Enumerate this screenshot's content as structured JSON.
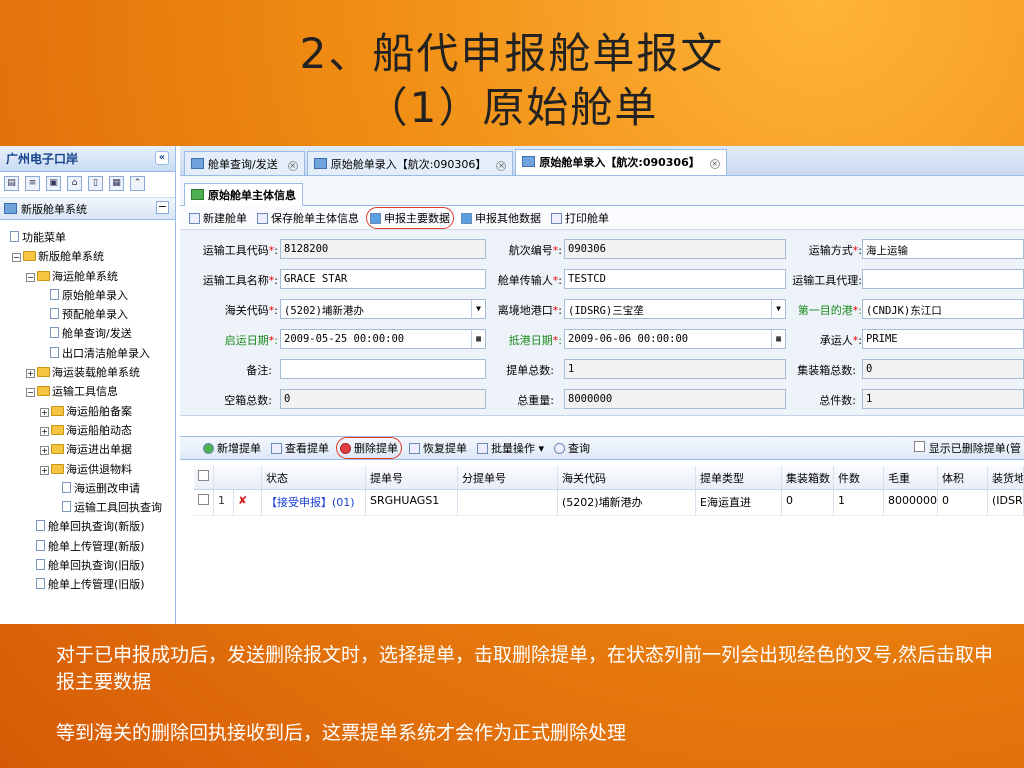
{
  "slide": {
    "title_line1": "2、船代申报舱单报文",
    "title_line2": "（1）原始舱单",
    "caption1": "对于已申报成功后，发送删除报文时，选择提单，击取删除提单，在状态列前一列会出现经色的叉号,然后击取申报主要数据",
    "caption2": "等到海关的删除回执接收到后，这票提单系统才会作为正式删除处理"
  },
  "left_panel": {
    "title": "广州电子口岸",
    "section": "新版舱单系统",
    "tree": {
      "root": "功能菜单",
      "l1": "新版舱单系统",
      "group_sea": "海运舱单系统",
      "sea_items": [
        "原始舱单录入",
        "预配舱单录入",
        "舱单查询/发送",
        "出口清洁舱单录入"
      ],
      "group_load": "海运装载舱单系统",
      "group_tool": "运输工具信息",
      "tool_items": [
        "海运船舶备案",
        "海运船舶动态",
        "海运进出单据",
        "海运供退物料",
        "海运删改申请",
        "运输工具回执查询"
      ],
      "extra_items": [
        "舱单回执查询(新版)",
        "舱单上传管理(新版)",
        "舱单回执查询(旧版)",
        "舱单上传管理(旧版)"
      ]
    }
  },
  "tabs": [
    {
      "label": "舱单查询/发送"
    },
    {
      "label": "原始舱单录入【航次:090306】"
    },
    {
      "label": "原始舱单录入【航次:090306】"
    }
  ],
  "subtab": "原始舱单主体信息",
  "toolbar": {
    "new": "新建舱单",
    "save": "保存舱单主体信息",
    "declare_main": "申报主要数据",
    "declare_other": "申报其他数据",
    "print": "打印舱单"
  },
  "form": {
    "tool_code_label": "运输工具代码",
    "tool_code": "8128200",
    "voyage_label": "航次编号",
    "voyage": "090306",
    "transport_mode_label": "运输方式",
    "transport_mode": "海上运输",
    "tool_name_label": "运输工具名称",
    "tool_name": "GRACE STAR",
    "carrier_label": "舱单传输人",
    "carrier": "TESTCD",
    "agent_label": "运输工具代理:",
    "agent": "",
    "customs_label": "海关代码",
    "customs": "(5202)埔新港办",
    "departure_port_label": "离境地港口",
    "departure_port": "(IDSRG)三宝垄",
    "dest_port_label": "第一目的港",
    "dest_port": "(CNDJK)东江口",
    "start_date_label": "启运日期",
    "start_date": "2009-05-25 00:00:00",
    "arrive_date_label": "抵港日期",
    "arrive_date": "2009-06-06 00:00:00",
    "shipper_label": "承运人",
    "shipper": "PRIME",
    "remark_label": "备注:",
    "remark": "",
    "bill_total_label": "提单总数:",
    "bill_total": "1",
    "container_total_label": "集装箱总数:",
    "container_total": "0",
    "empty_total_label": "空箱总数:",
    "empty_total": "0",
    "weight_label": "总重量:",
    "weight": "8000000",
    "pieces_label": "总件数:",
    "pieces": "1"
  },
  "grid_toolbar": {
    "add": "新增提单",
    "view": "查看提单",
    "delete": "删除提单",
    "restore": "恢复提单",
    "batch": "批量操作",
    "query": "查询",
    "show_deleted": "显示已删除提单(管"
  },
  "grid": {
    "headers": [
      "状态",
      "提单号",
      "分提单号",
      "海关代码",
      "提单类型",
      "集装箱数",
      "件数",
      "毛重",
      "体积",
      "装货地"
    ],
    "rows": [
      {
        "index": "1",
        "status": "【接受申报】(01)",
        "bill_no": "SRGHUAGS1",
        "sub_bill": "",
        "customs": "(5202)埔新港办",
        "type": "E海运直进",
        "containers": "0",
        "pieces": "1",
        "weight": "8000000",
        "volume": "0",
        "load_place": "(IDSRG"
      }
    ]
  },
  "colors": {
    "accent": "#e03a2a",
    "status_blue": "#1a3fd0",
    "delete_mark": "#d02020"
  }
}
